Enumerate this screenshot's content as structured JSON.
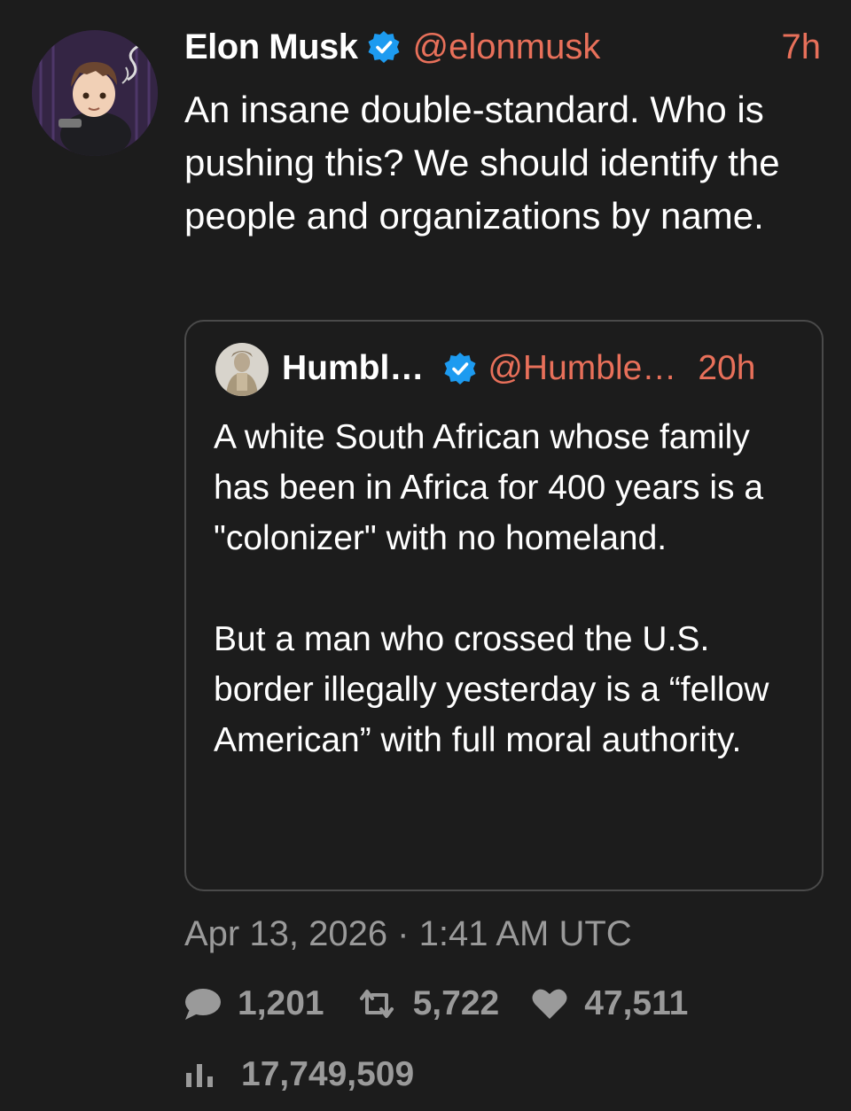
{
  "tweet": {
    "author_name": "Elon Musk",
    "handle": "@elonmusk",
    "time": "7h",
    "text": "An insane double-standard. Who is pushing this? We should identify the people and organizations by name.",
    "avatar_icon": "anime-avatar-icon",
    "verified_icon": "verified-badge-icon"
  },
  "quote": {
    "author_name": "Humbl…",
    "handle": "@Humble…",
    "time": "20h",
    "paragraphs": [
      "A white South African whose family has been in Africa for 400 years is a \"colonizer\" with no homeland.",
      "But a man who crossed the U.S. border illegally yesterday is a “fellow American” with full moral authority."
    ],
    "avatar_icon": "statue-avatar-icon"
  },
  "timestamp": "Apr 13, 2026 · 1:41 AM UTC",
  "stats": {
    "replies": "1,201",
    "retweets": "5,722",
    "likes": "47,511",
    "views": "17,749,509"
  },
  "colors": {
    "background": "#1c1c1c",
    "accent": "#e8705a",
    "verified": "#1d9bf0",
    "muted": "#9a9a9a",
    "border": "#4a4a4a"
  }
}
